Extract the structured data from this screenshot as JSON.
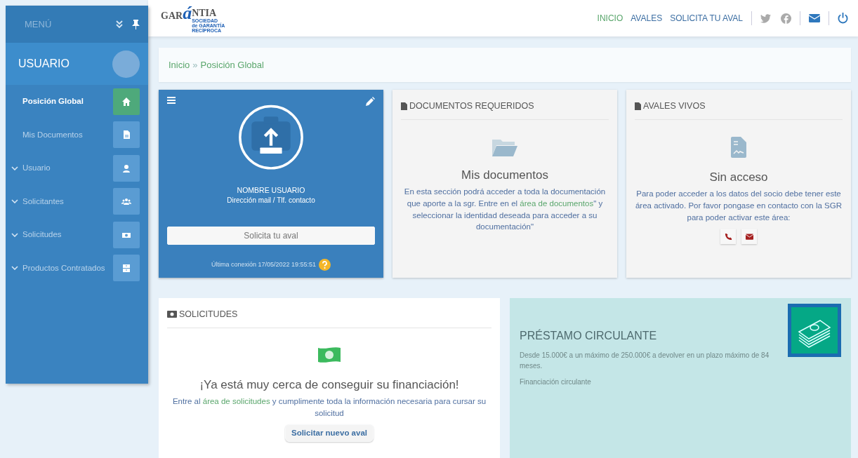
{
  "sidebar": {
    "title": "MENÚ",
    "user": "USUARIO",
    "items": [
      {
        "label": "Posición Global",
        "kind": "link",
        "selected": true
      },
      {
        "label": "Mis Documentos",
        "kind": "link",
        "selected": false
      },
      {
        "label": "Usuario",
        "kind": "group",
        "selected": false
      },
      {
        "label": "Solicitantes",
        "kind": "group",
        "selected": false
      },
      {
        "label": "Solicitudes",
        "kind": "group",
        "selected": false
      },
      {
        "label": "Productos Contratados",
        "kind": "group",
        "selected": false
      }
    ]
  },
  "logo": {
    "left": "GAR",
    "accent": "á",
    "right": "NTIA",
    "subtitle": [
      "SOCIEDAD",
      "de GARANTÍA",
      "RECÍPROCA"
    ]
  },
  "nav": [
    {
      "label": "INICIO",
      "selected": true
    },
    {
      "label": "AVALES",
      "selected": false
    },
    {
      "label": "SOLICITA TU AVAL",
      "selected": false
    }
  ],
  "breadcrumb": {
    "home": "Inicio",
    "separator": "»",
    "current": "Posición Global"
  },
  "profile": {
    "name": "NOMBRE USUARIO",
    "contact": "Dirección mail / Tlf. contacto",
    "button": "Solicita tu aval",
    "last_login": "Última conexión 17/05/2022 19:55:51"
  },
  "documents": {
    "header": "DOCUMENTOS REQUERIDOS",
    "title": "Mis documentos",
    "text_before": "En esta sección podrá acceder a toda la documentación que aporte a la sgr. Entre en el",
    "link": "área de documentos",
    "text_after": "\" y seleccionar la identidad deseada para acceder a su documentación\""
  },
  "avales": {
    "header": "AVALES VIVOS",
    "title": "Sin acceso",
    "text": "Para poder acceder a los datos del socio debe tener este área activado. Por favor pongase en contacto con la SGR para poder activar este área:"
  },
  "solicitudes": {
    "header": "SOLICITUDES",
    "title": "¡Ya está muy cerca de conseguir su financiación!",
    "text_before": "Entre al",
    "link": "área de solicitudes",
    "text_after": "y cumplimente toda la información necesaria para cursar su solicitud",
    "button": "Solicitar nuevo aval"
  },
  "product": {
    "title": "PRÉSTAMO CIRCULANTE",
    "description": "Desde 15.000€ a un máximo de 250.000€ a devolver en un plazo máximo de 84 meses.",
    "subtitle": "Financiación circulante"
  }
}
